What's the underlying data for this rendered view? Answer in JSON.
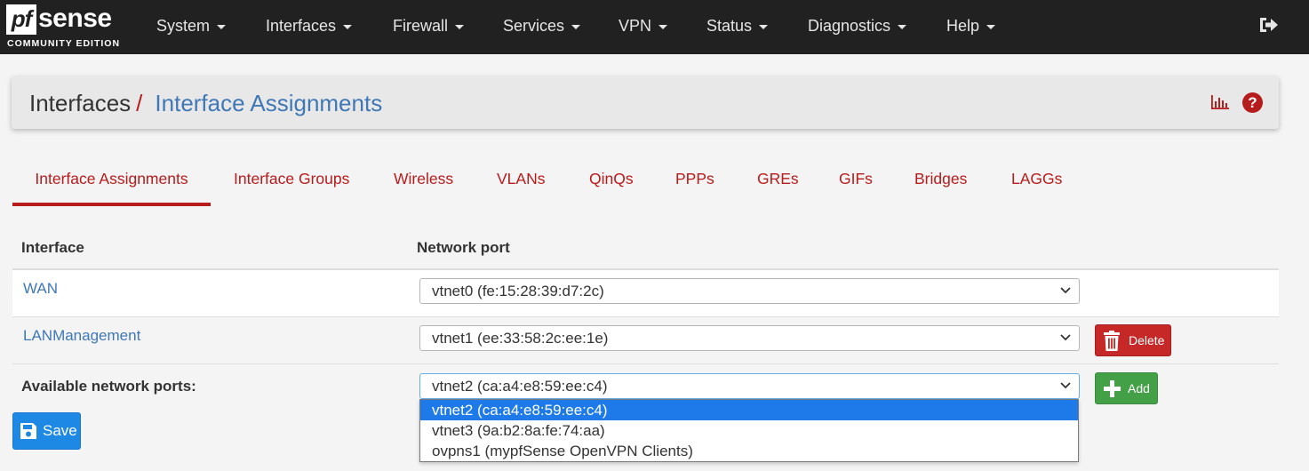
{
  "brand": {
    "logo_pf": "pf",
    "logo_name": "sense",
    "edition": "COMMUNITY EDITION"
  },
  "nav": {
    "items": [
      "System",
      "Interfaces",
      "Firewall",
      "Services",
      "VPN",
      "Status",
      "Diagnostics",
      "Help"
    ],
    "logout_icon": "sign-out-icon"
  },
  "breadcrumb": {
    "parent": "Interfaces",
    "separator": "/",
    "current": "Interface Assignments",
    "icons": [
      "bar-chart-icon",
      "question-circle-icon"
    ],
    "help_glyph": "?"
  },
  "tabs": {
    "items": [
      "Interface Assignments",
      "Interface Groups",
      "Wireless",
      "VLANs",
      "QinQs",
      "PPPs",
      "GREs",
      "GIFs",
      "Bridges",
      "LAGGs"
    ],
    "active": "Interface Assignments"
  },
  "table": {
    "headers": {
      "interface": "Interface",
      "network_port": "Network port"
    },
    "rows": [
      {
        "interface": "WAN",
        "port": "vtnet0 (fe:15:28:39:d7:2c)"
      },
      {
        "interface": "LANManagement",
        "port": "vtnet1 (ee:33:58:2c:ee:1e)",
        "action": "Delete"
      }
    ],
    "available": {
      "label": "Available network ports:",
      "selected": "vtnet2 (ca:a4:e8:59:ee:c4)",
      "action": "Add",
      "options": [
        "vtnet2 (ca:a4:e8:59:ee:c4)",
        "vtnet3 (9a:b2:8a:fe:74:aa)",
        "ovpns1 (mypfSense OpenVPN Clients)"
      ]
    }
  },
  "actions": {
    "save": "Save"
  },
  "colors": {
    "navbar": "#212121",
    "accent_red": "#b71c1c",
    "link_blue": "#3f78b5",
    "delete_red": "#c62828",
    "add_green": "#43a047",
    "save_blue": "#1e88e5",
    "selection_blue": "#1e7ae8"
  }
}
